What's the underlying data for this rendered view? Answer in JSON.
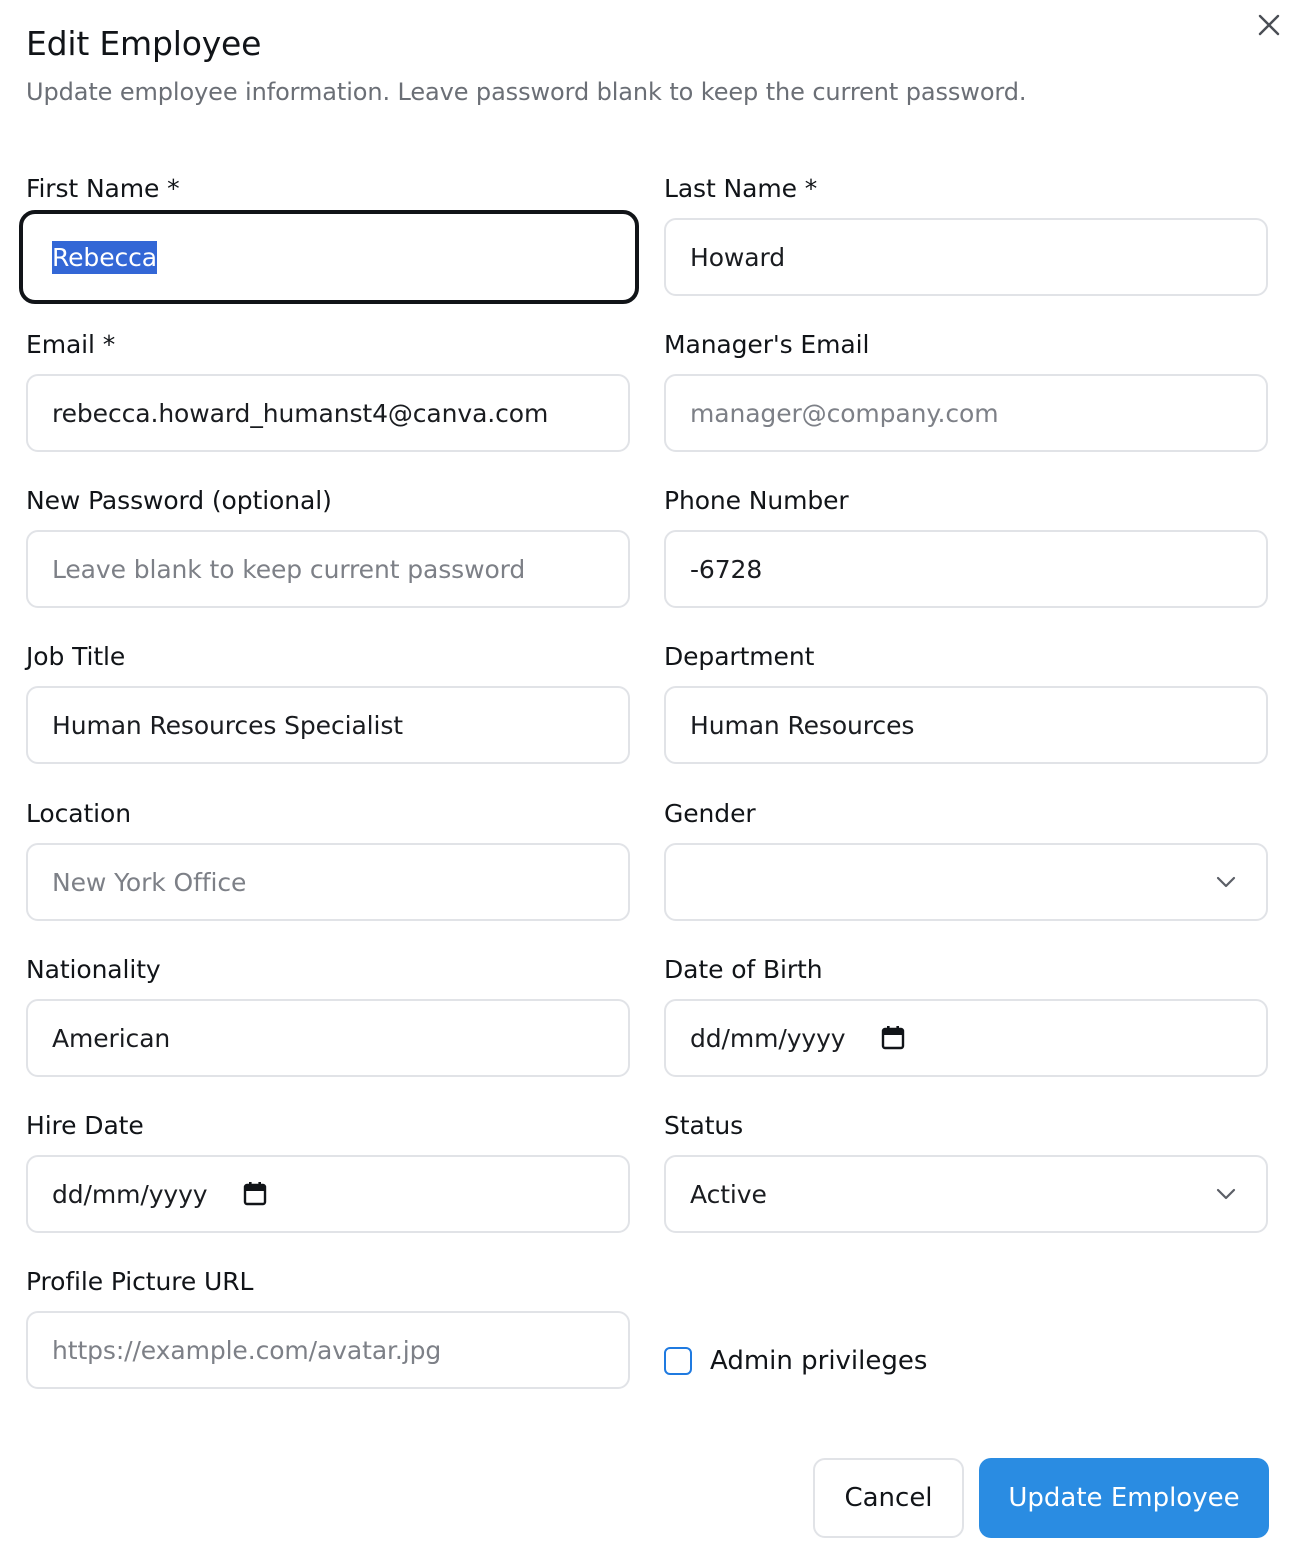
{
  "dialog": {
    "title": "Edit Employee",
    "subtitle": "Update employee information. Leave password blank to keep the current password.",
    "close_icon": "close-icon"
  },
  "form": {
    "first_name": {
      "label": "First Name *",
      "value": "Rebecca"
    },
    "last_name": {
      "label": "Last Name *",
      "value": "Howard"
    },
    "email": {
      "label": "Email *",
      "value": "rebecca.howard_humanst4@canva.com"
    },
    "manager_email": {
      "label": "Manager's Email",
      "placeholder": "manager@company.com"
    },
    "new_password": {
      "label": "New Password (optional)",
      "placeholder": "Leave blank to keep current password"
    },
    "phone": {
      "label": "Phone Number",
      "value": "-6728"
    },
    "job_title": {
      "label": "Job Title",
      "value": "Human Resources Specialist"
    },
    "department": {
      "label": "Department",
      "value": "Human Resources"
    },
    "location": {
      "label": "Location",
      "placeholder": "New York Office"
    },
    "gender": {
      "label": "Gender",
      "value": ""
    },
    "nationality": {
      "label": "Nationality",
      "value": "American"
    },
    "date_of_birth": {
      "label": "Date of Birth",
      "placeholder": "dd/mm/yyyy"
    },
    "hire_date": {
      "label": "Hire Date",
      "placeholder": "dd/mm/yyyy"
    },
    "status": {
      "label": "Status",
      "value": "Active"
    },
    "profile_picture_url": {
      "label": "Profile Picture URL",
      "placeholder": "https://example.com/avatar.jpg"
    },
    "admin": {
      "label": "Admin privileges",
      "checked": false
    }
  },
  "actions": {
    "cancel_label": "Cancel",
    "submit_label": "Update Employee"
  },
  "colors": {
    "accent": "#2a8ce2",
    "selection": "#3367d6",
    "border": "#e1e3e7",
    "focus_border": "#111418",
    "placeholder": "#7d8087"
  }
}
